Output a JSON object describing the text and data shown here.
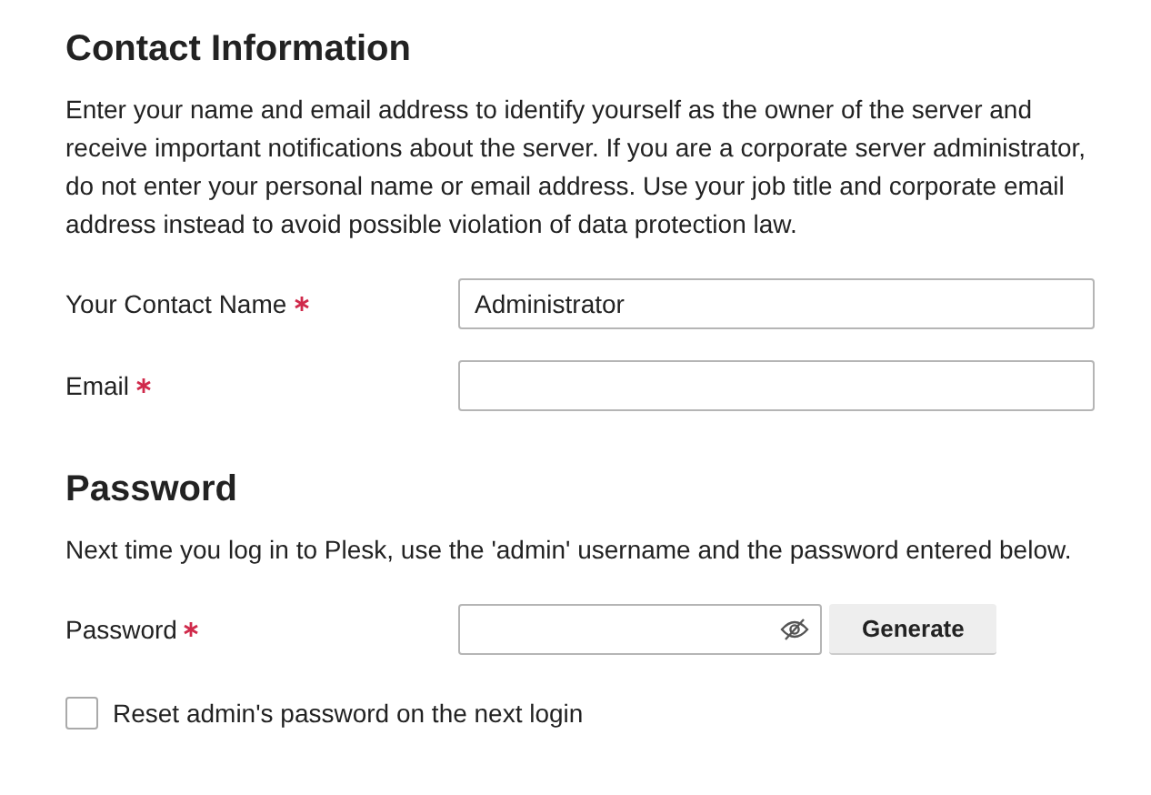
{
  "sections": [
    {
      "title": "Contact Information",
      "description": "Enter your name and email address to identify yourself as the owner of the server and receive important notifications about the server. If you are a corporate server administrator, do not enter your personal name or email address. Use your job title and corporate email address instead to avoid possible violation of data protection law.",
      "fields": [
        {
          "kind": "text",
          "label": "Your Contact Name",
          "required": true,
          "value": "Administrator"
        },
        {
          "kind": "text",
          "label": "Email",
          "required": true
        }
      ]
    },
    {
      "title": "Password",
      "description": "Next time you log in to Plesk, use the 'admin' username and the password entered below.",
      "fields": [
        {
          "kind": "password",
          "label": "Password",
          "required": true,
          "button": "Generate"
        },
        {
          "kind": "checkbox",
          "label": "Reset admin's password on the next login",
          "checked": false
        }
      ]
    }
  ]
}
